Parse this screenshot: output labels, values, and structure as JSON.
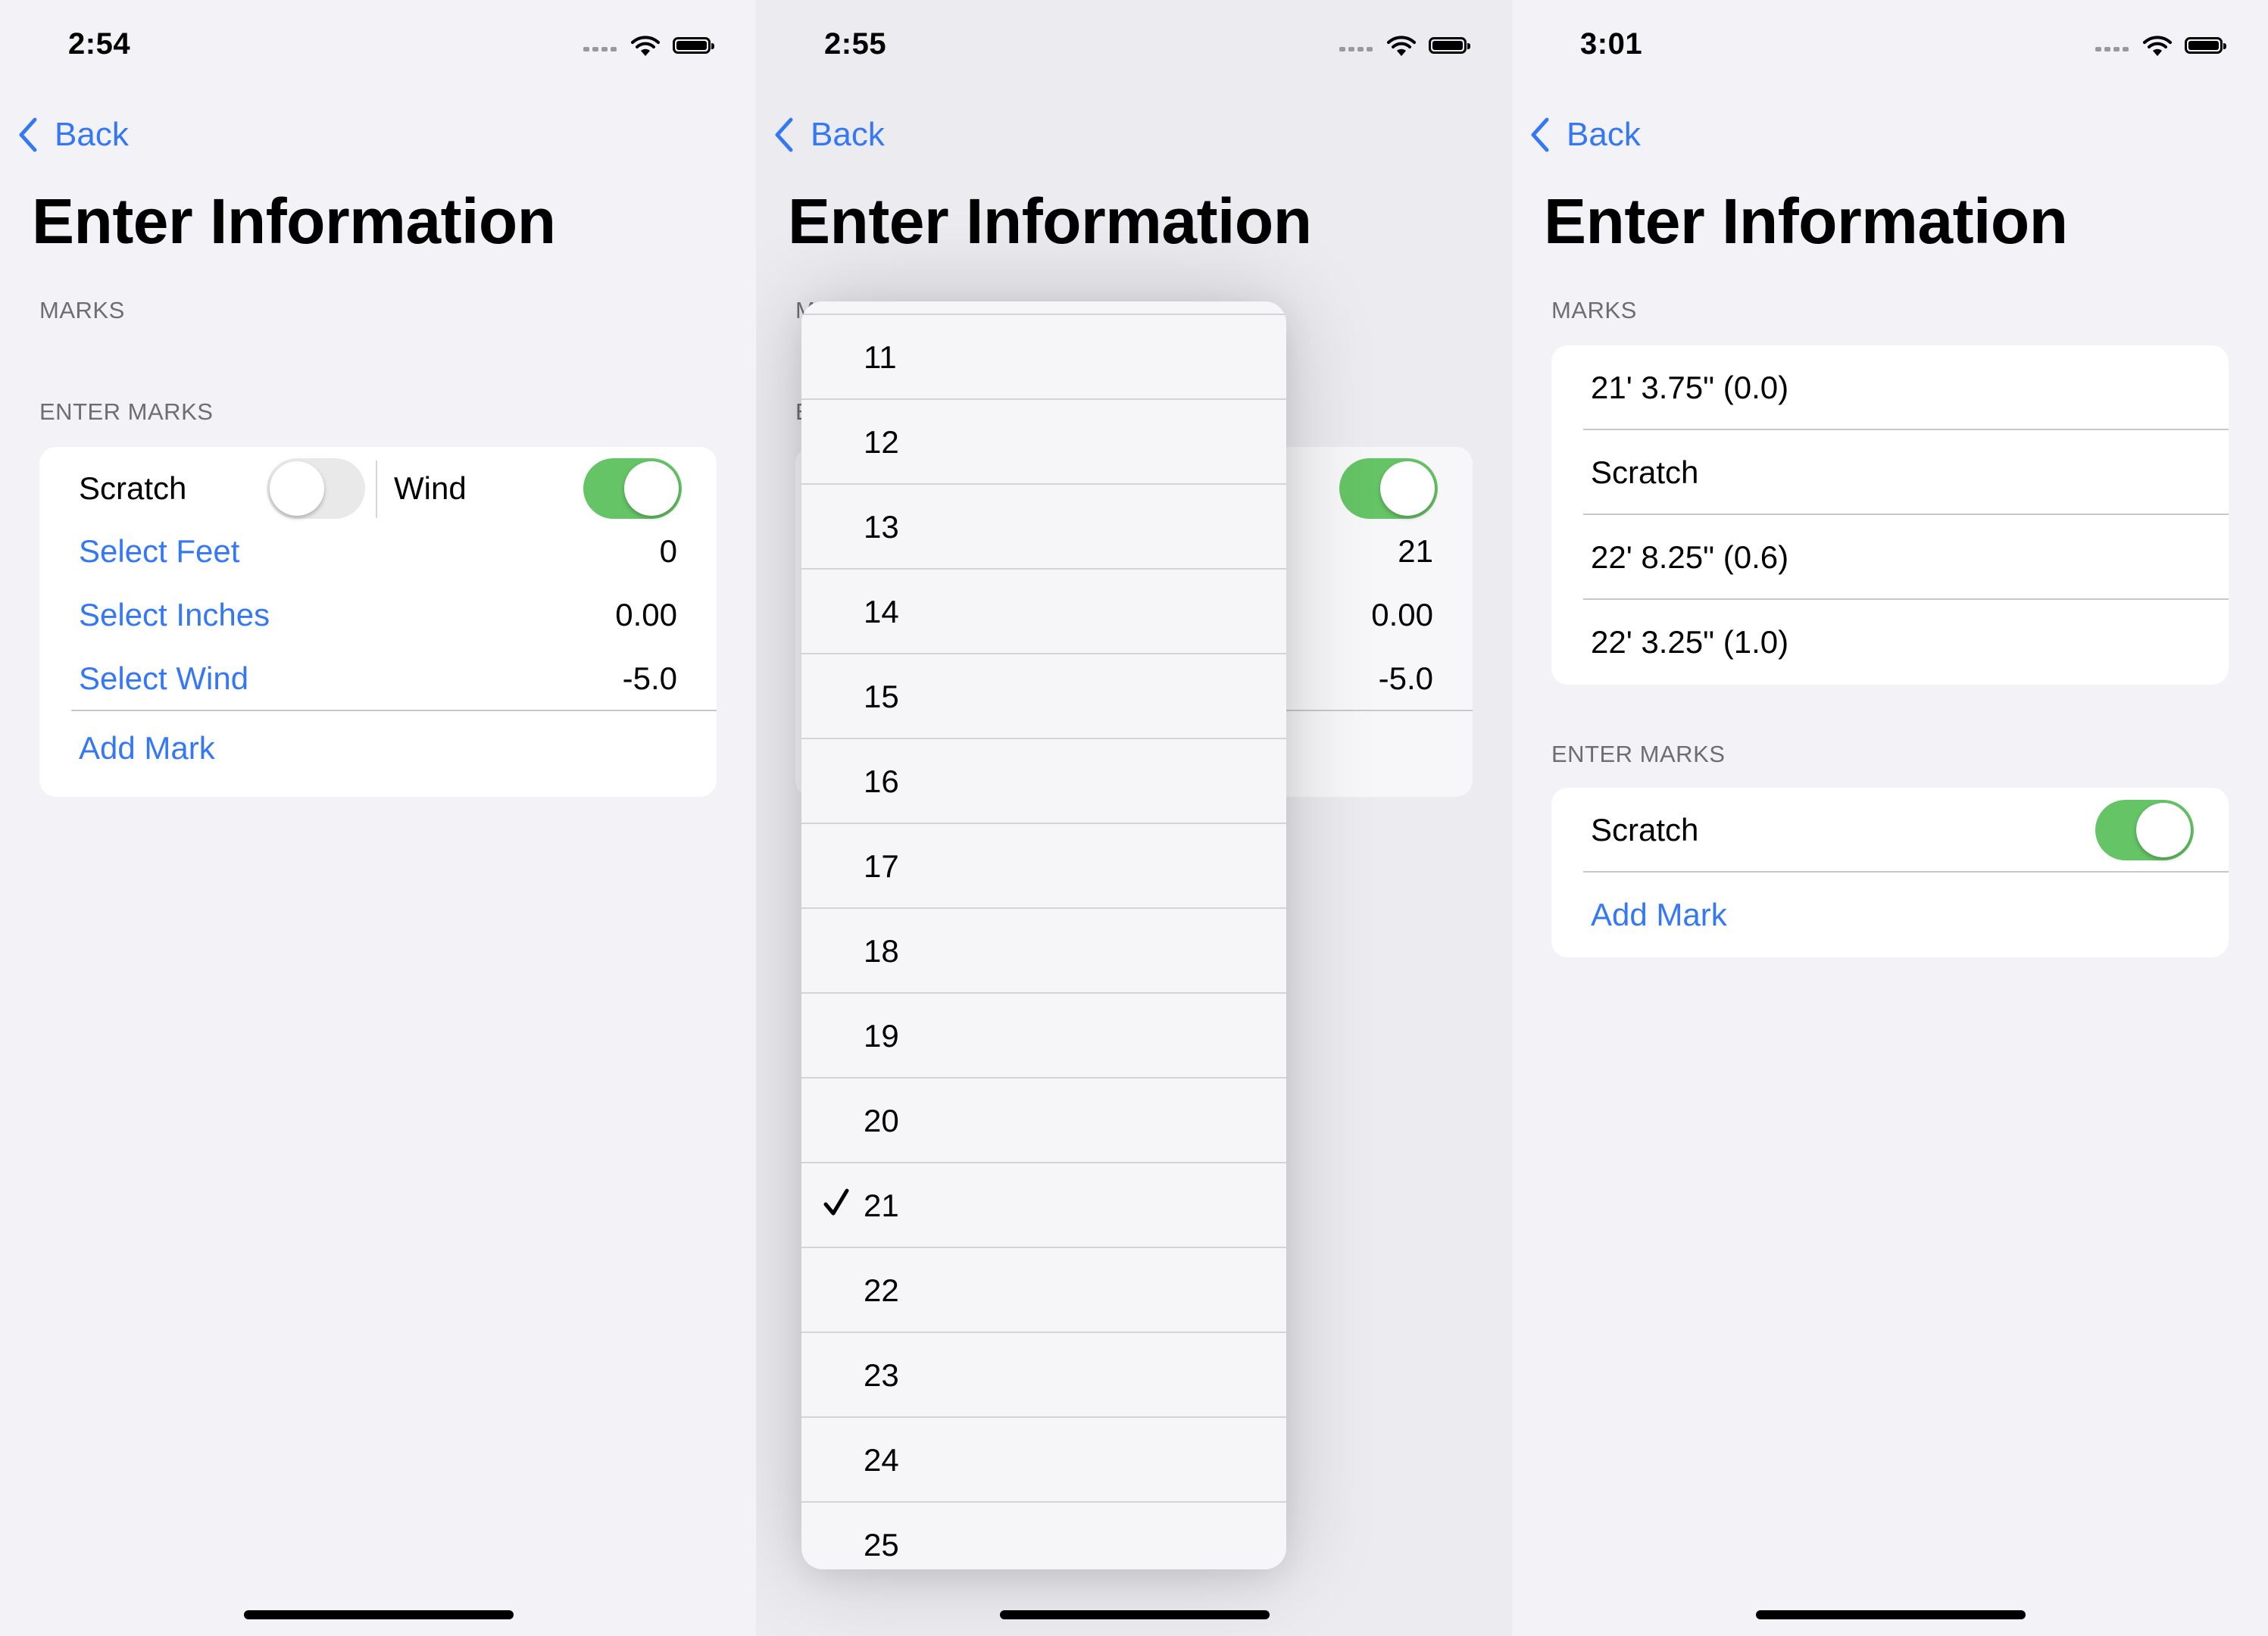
{
  "screens": [
    {
      "status": {
        "time": "2:54"
      },
      "nav": {
        "back_label": "Back"
      },
      "title": "Enter Information",
      "marks_header": "MARKS",
      "enter_header": "ENTER MARKS",
      "scratch_label": "Scratch",
      "scratch_on": false,
      "wind_label": "Wind",
      "wind_on": true,
      "feet_label": "Select Feet",
      "feet_value": "0",
      "inches_label": "Select Inches",
      "inches_value": "0.00",
      "wind_select_label": "Select Wind",
      "wind_value": "-5.0",
      "add_label": "Add Mark"
    },
    {
      "status": {
        "time": "2:55"
      },
      "nav": {
        "back_label": "Back"
      },
      "title": "Enter Information",
      "marks_header_partial": "M",
      "enter_header_partial": "E",
      "wind_on": true,
      "feet_value": "21",
      "inches_value": "0.00",
      "wind_value": "-5.0",
      "menu_items": [
        "11",
        "12",
        "13",
        "14",
        "15",
        "16",
        "17",
        "18",
        "19",
        "20",
        "21",
        "22",
        "23",
        "24",
        "25"
      ],
      "menu_selected": "21"
    },
    {
      "status": {
        "time": "3:01"
      },
      "nav": {
        "back_label": "Back"
      },
      "title": "Enter Information",
      "marks_header": "MARKS",
      "marks": [
        "21' 3.75\" (0.0)",
        "Scratch",
        "22' 8.25\" (0.6)",
        "22' 3.25\" (1.0)"
      ],
      "enter_header": "ENTER MARKS",
      "scratch_label": "Scratch",
      "scratch_on": true,
      "add_label": "Add Mark"
    }
  ],
  "colors": {
    "accent": "#3478f6",
    "toggle_on": "#65c466",
    "background": "#f2f2f7"
  }
}
